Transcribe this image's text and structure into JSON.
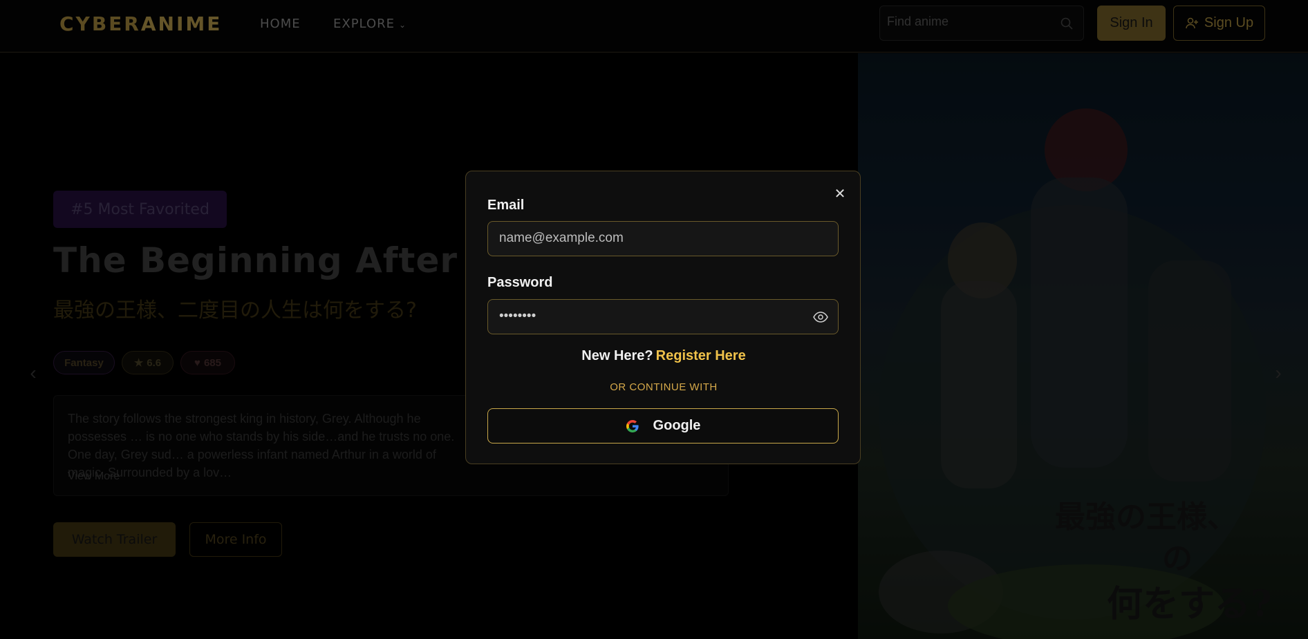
{
  "nav": {
    "logo_a": "CYBER",
    "logo_b": "ANIME",
    "home": "HOME",
    "explore": "EXPLORE",
    "search_placeholder": "Find anime",
    "sign_in": "Sign In",
    "sign_up": "Sign Up"
  },
  "hero": {
    "badge": "#5 Most Favorited",
    "title": "The Beginning After the",
    "subtitle": "最強の王様、二度目の人生は何をする?",
    "genre": "Fantasy",
    "rating": "6.6",
    "likes": "685",
    "description": "The story follows the strongest king in history, Grey. Although he possesses … is no one who stands by his side…and he trusts no one. One day, Grey sud… a powerless infant named Arthur in a world of magic. Surrounded by a lov…",
    "view_more": "View More",
    "watch_trailer": "Watch Trailer",
    "more_info": "More Info",
    "poster_text_1": "最強の王様、",
    "poster_text_2": "の",
    "poster_text_3": "何をする?"
  },
  "modal": {
    "email_label": "Email",
    "email_placeholder": "name@example.com",
    "password_label": "Password",
    "password_value": "••••••••",
    "new_here": "New Here?",
    "register_link": "Register Here",
    "divider": "OR CONTINUE WITH",
    "google": "Google"
  },
  "colors": {
    "accent": "#c9a84a",
    "link": "#f0c24a",
    "modal_bg": "#0e0e0e"
  }
}
